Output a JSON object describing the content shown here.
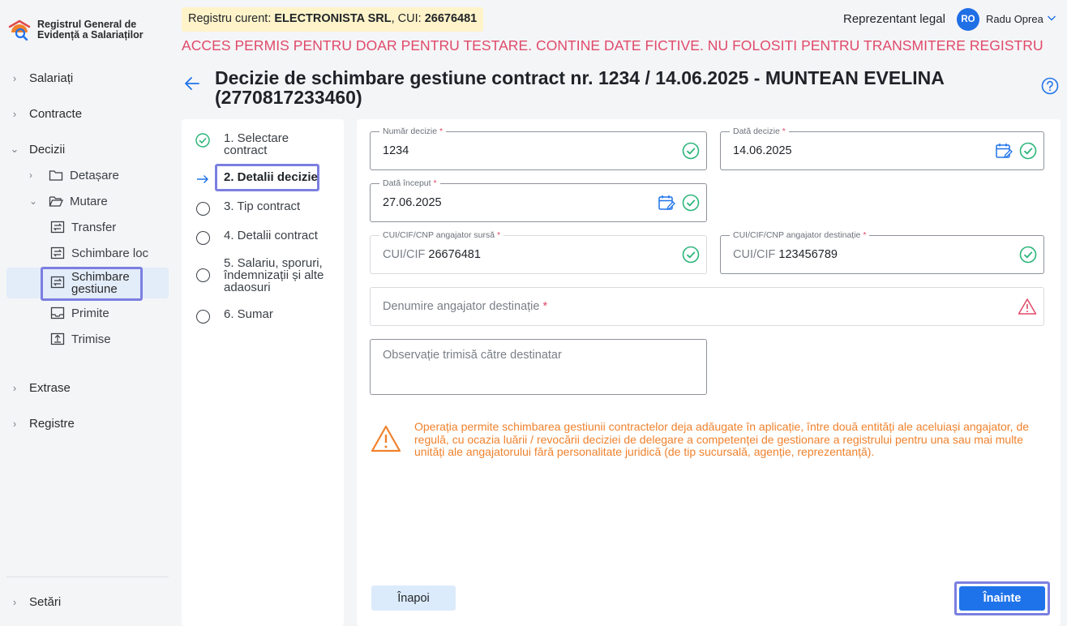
{
  "app": {
    "name_line1": "Registrul General de",
    "name_line2": "Evidență a Salariaților"
  },
  "header": {
    "registry_prefix": "Registru curent: ",
    "registry_company": "ELECTRONISTA SRL",
    "registry_cui_prefix": ", CUI: ",
    "registry_cui": "26676481",
    "role": "Reprezentant legal",
    "avatar_initials": "RO",
    "user_name": "Radu Oprea",
    "warning_banner": "ACCES PERMIS PENTRU DOAR PENTRU TESTARE. CONTINE DATE FICTIVE. NU FOLOSITI PENTRU TRANSMITERE REGISTRU"
  },
  "sidebar": {
    "salariati": "Salariați",
    "contracte": "Contracte",
    "decizii": "Decizii",
    "detasare": "Detașare",
    "mutare": "Mutare",
    "transfer": "Transfer",
    "schimbare_loc": "Schimbare loc",
    "schimbare_gestiune_line1": "Schimbare",
    "schimbare_gestiune_line2": "gestiune",
    "primite": "Primite",
    "trimise": "Trimise",
    "extrase": "Extrase",
    "registre": "Registre",
    "setari": "Setări"
  },
  "page": {
    "title": "Decizie de schimbare gestiune contract nr. 1234 / 14.06.2025 - MUNTEAN EVELINA (2770817233460)"
  },
  "steps": {
    "s1_line1": "1. Selectare",
    "s1_line2": "contract",
    "s2": "2. Detalii decizie",
    "s3": "3. Tip contract",
    "s4": "4. Detalii contract",
    "s5_line1": "5. Salariu, sporuri,",
    "s5_line2": "îndemnizații și alte",
    "s5_line3": "adaosuri",
    "s6": "6. Sumar"
  },
  "form": {
    "numar_label": "Număr decizie",
    "numar_value": "1234",
    "data_decizie_label": "Dată decizie",
    "data_decizie_value": "14.06.2025",
    "data_inceput_label": "Dată început",
    "data_inceput_value": "27.06.2025",
    "sursa_label": "CUI/CIF/CNP angajator sursă",
    "sursa_prefix": "CUI/CIF",
    "sursa_value": "26676481",
    "dest_label": "CUI/CIF/CNP angajator destinație",
    "dest_prefix": "CUI/CIF",
    "dest_value": "123456789",
    "denumire_placeholder": "Denumire angajator destinație",
    "required_mark": "*",
    "observatie_placeholder": "Observație trimisă către destinatar",
    "info_text": "Operația permite schimbarea gestiunii contractelor deja adăugate în aplicație, între două entități ale aceluiași angajator, de regulă, cu ocazia luării / revocării deciziei de delegare a competenței de gestionare a registrului pentru una sau mai multe unități ale angajatorului fără personalitate juridică (de tip sucursală, agenție, reprezentanță).",
    "back_button": "Înapoi",
    "next_button": "Înainte"
  },
  "colors": {
    "accent": "#1f73ea",
    "success": "#2bb57a",
    "warning": "#e04a6a",
    "info_orange": "#f0822d",
    "focus_outline": "#7b7fe0"
  }
}
